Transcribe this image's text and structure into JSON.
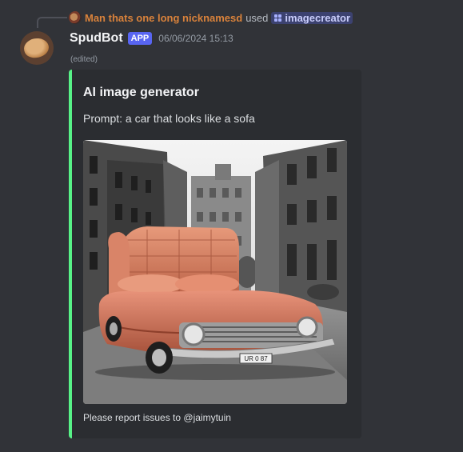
{
  "reply": {
    "nickname": "Man thats one long nicknamesd",
    "used_text": "used",
    "command": "imagecreator"
  },
  "message": {
    "username": "SpudBot",
    "badge": "APP",
    "timestamp": "06/06/2024 15:13",
    "edited": "(edited)"
  },
  "embed": {
    "title": "AI image generator",
    "description": "Prompt: a car that looks like a sofa",
    "footer": "Please report issues to @jaimytuin",
    "image_alt": "Generated image of a salmon-colored car shaped like a sofa on a black-and-white city street",
    "plate_text": "UR 0 87",
    "accent_color": "#57f287"
  },
  "colors": {
    "background": "#313338",
    "embed_bg": "#2b2d31",
    "badge": "#5865f2",
    "nickname": "#d9823b"
  }
}
